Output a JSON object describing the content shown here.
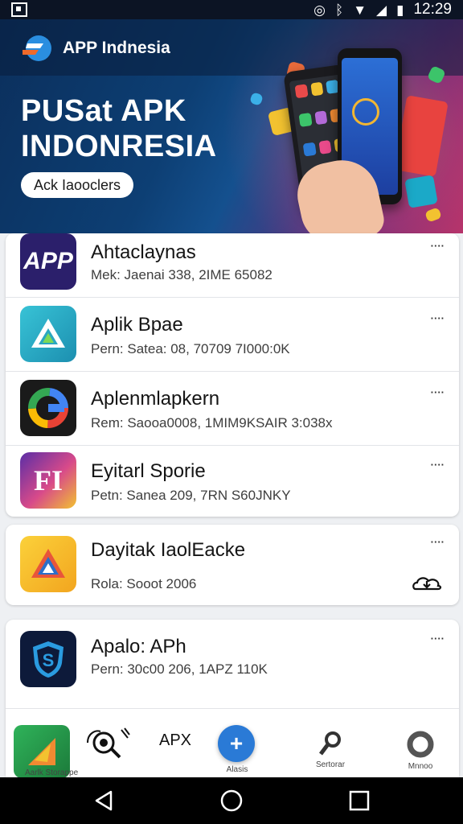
{
  "status_bar": {
    "time": "12:29",
    "icons": [
      "app-square-icon",
      "alarm-icon",
      "bluetooth-icon",
      "wifi-icon",
      "signal-icon",
      "battery-icon"
    ]
  },
  "banner": {
    "brand": "APP Indnesia",
    "title_line1": "PUSat APK",
    "title_line2": "INDONRESIA",
    "pill_label": "Ack Iaooclers"
  },
  "apps": [
    {
      "name": "Ahtaclaynas",
      "meta": "Mek: Jaenai 338, 2IME 65082",
      "icon": "app-text-icon",
      "menu": "····"
    },
    {
      "name": "Aplik Bpae",
      "meta": "Pern: Satea: 08, 70709 7I000:0K",
      "icon": "triangle-play-icon",
      "menu": "····"
    },
    {
      "name": "Aplenmlapkern",
      "meta": "Rem: Saooa0008, 1MIM9KSAIR 3:038x",
      "icon": "google-g-icon",
      "menu": "····"
    },
    {
      "name": "Eyitarl Sporie",
      "meta": "Petn: Sanea 209, 7RN S60JNKY",
      "icon": "fi-letters-icon",
      "menu": "····"
    },
    {
      "name": "Dayitak IaolEacke",
      "meta": "Rola: Sooot 2006",
      "icon": "triangle-a-icon",
      "menu": "····",
      "action_icon": "download-cloud-icon"
    },
    {
      "name": "Apalo: APh",
      "meta": "Pern: 30c00 206, 1APZ 110K",
      "icon": "shield-s-icon",
      "menu": "····"
    }
  ],
  "bottom_nav": {
    "item1_label": "Aarlk Storappe",
    "item2_label": "APX",
    "fab_label": "Alasis",
    "item4_label": "Sertorar",
    "item5_label": "Mnnoo"
  },
  "colors": {
    "accent": "#2a7ad6",
    "banner_bg": "#0d3f74",
    "status_bar": "#0c1424"
  }
}
